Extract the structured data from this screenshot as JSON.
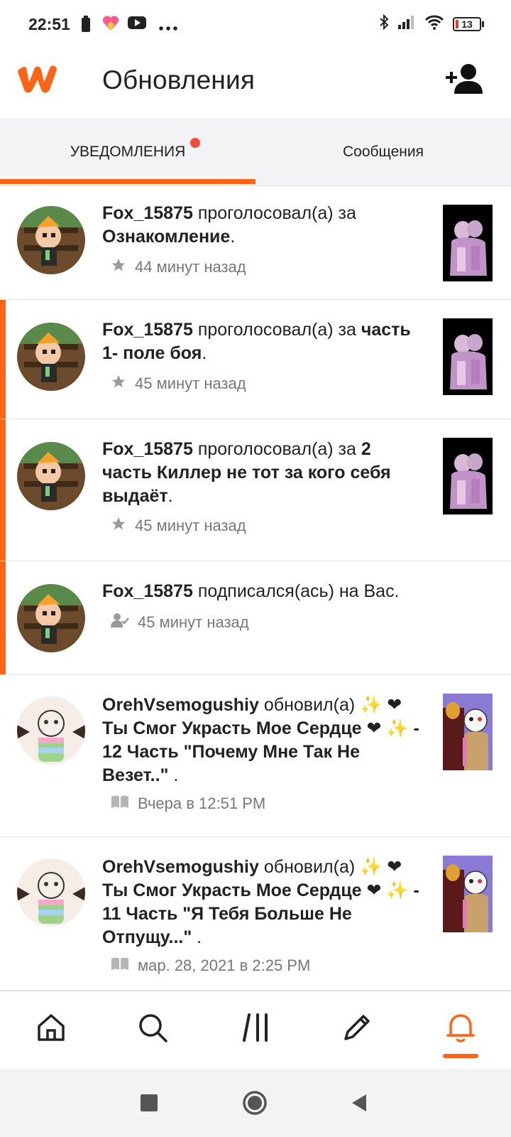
{
  "status_bar": {
    "time": "22:51",
    "battery": "13",
    "icons": [
      "battery-icon",
      "likee-icon",
      "youtube-icon",
      "more-dots-icon",
      "bluetooth-icon",
      "signal-icon",
      "wifi-icon"
    ]
  },
  "header": {
    "title": "Обновления",
    "logo": "wattpad-logo",
    "action_icon": "add-user-icon"
  },
  "tabs": [
    {
      "label": "УВЕДОМЛЕНИЯ",
      "active": true,
      "has_dot": true
    },
    {
      "label": "Сообщения",
      "active": false
    }
  ],
  "notifications": [
    {
      "user": "Fox_15875",
      "action": " проголосовал(а) за ",
      "target": "Ознакомление",
      "suffix": ".",
      "time": "44 минут назад",
      "meta_icon": "star-icon",
      "unread": false
    },
    {
      "user": "Fox_15875",
      "action": " проголосовал(а) за ",
      "target": "часть 1- поле боя",
      "suffix": ".",
      "time": "45 минут назад",
      "meta_icon": "star-icon",
      "unread": true
    },
    {
      "user": "Fox_15875",
      "action": " проголосовал(а) за ",
      "target": "2 часть Киллер не тот за кого себя выдаёт",
      "suffix": ".",
      "time": "45 минут назад",
      "meta_icon": "star-icon",
      "unread": true
    },
    {
      "user": "Fox_15875",
      "action": " подписался(ась) на Вас.",
      "target": "",
      "suffix": "",
      "time": "45 минут назад",
      "meta_icon": "follow-icon",
      "unread": true
    },
    {
      "user": "OrehVsemogushiy",
      "action": " обновил(а) ",
      "target": "✨ ❤Ты Смог Украсть Мое Сердце ❤ ✨ - 12 Часть \"Почему Мне Так Не Везет..\"",
      "suffix": " .",
      "time": "Вчера в 12:51 PM",
      "meta_icon": "book-icon",
      "unread": false
    },
    {
      "user": "OrehVsemogushiy",
      "action": " обновил(а) ",
      "target": "✨ ❤Ты Смог Украсть Мое Сердце ❤ ✨ - 11 Часть \"Я Тебя Больше Не Отпущу...\"",
      "suffix": " .",
      "time": "мар. 28, 2021 в 2:25 PM",
      "meta_icon": "book-icon",
      "unread": false
    }
  ],
  "bottom_nav": [
    {
      "icon": "home-icon",
      "active": false
    },
    {
      "icon": "search-icon",
      "active": false
    },
    {
      "icon": "library-icon",
      "active": false
    },
    {
      "icon": "write-icon",
      "active": false
    },
    {
      "icon": "bell-icon",
      "active": true
    }
  ],
  "colors": {
    "accent": "#ff6414",
    "dot": "#f04e34",
    "tab_bg": "#f3f2f5"
  }
}
